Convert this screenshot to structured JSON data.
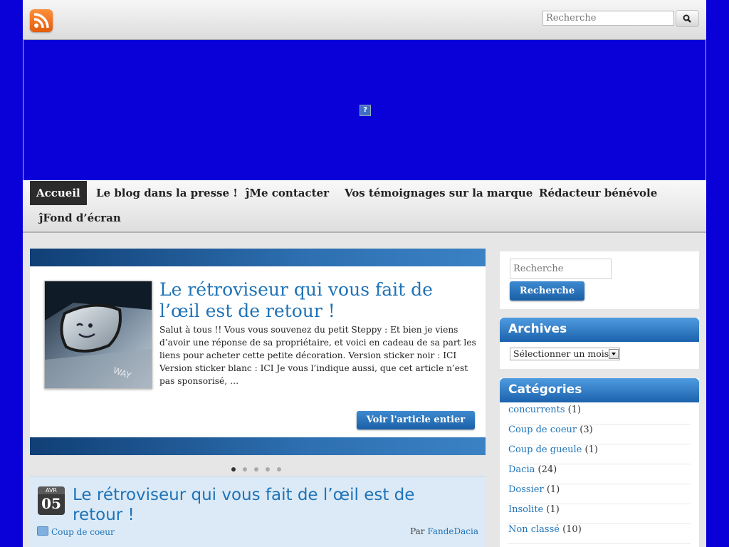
{
  "header": {
    "rss_icon": "rss-icon",
    "search_placeholder": "Recherche",
    "search_icon": "magnifier-icon"
  },
  "banner": {
    "image": "broken-image-icon"
  },
  "nav": {
    "items": [
      {
        "label": "Accueil",
        "active": true
      },
      {
        "label": "Le blog dans la presse !"
      },
      {
        "label": "ĵMe contacter"
      },
      {
        "label": "Vos témoignages sur la marque"
      },
      {
        "label": "Rédacteur bénévole"
      },
      {
        "label": "ĵFond d’écran"
      }
    ]
  },
  "slider": {
    "title": "Le rétroviseur qui vous fait de l’œil est de retour !",
    "excerpt": "Salut à tous !! Vous vous souvenez du petit Steppy : Et bien je viens d’avoir une réponse de sa propriétaire, et voici en cadeau de sa part les liens pour acheter cette petite décoration. Version sticker noir : ICI Version sticker blanc : ICI Je vous l’indique aussi, que cet article n’est pas sponsorisé, …",
    "button": "Voir l'article entier",
    "dots": 5,
    "active_dot": 0
  },
  "post": {
    "date_month": "AVR",
    "date_day": "05",
    "title": "Le rétroviseur qui vous fait de l’œil est de retour !",
    "category": "Coup de coeur",
    "by_label": "Par",
    "author": "FandeDacia"
  },
  "sidebar": {
    "search_placeholder": "Recherche",
    "search_button": "Recherche",
    "archives_title": "Archives",
    "archives_select": "Sélectionner un mois",
    "categories_title": "Catégories",
    "categories": [
      {
        "name": "concurrents",
        "count": "(1)"
      },
      {
        "name": "Coup de coeur",
        "count": "(3)"
      },
      {
        "name": "Coup de gueule",
        "count": "(1)"
      },
      {
        "name": "Dacia",
        "count": "(24)"
      },
      {
        "name": "Dossier",
        "count": "(1)"
      },
      {
        "name": "Insolite",
        "count": "(1)"
      },
      {
        "name": "Non classé",
        "count": "(10)"
      }
    ]
  }
}
